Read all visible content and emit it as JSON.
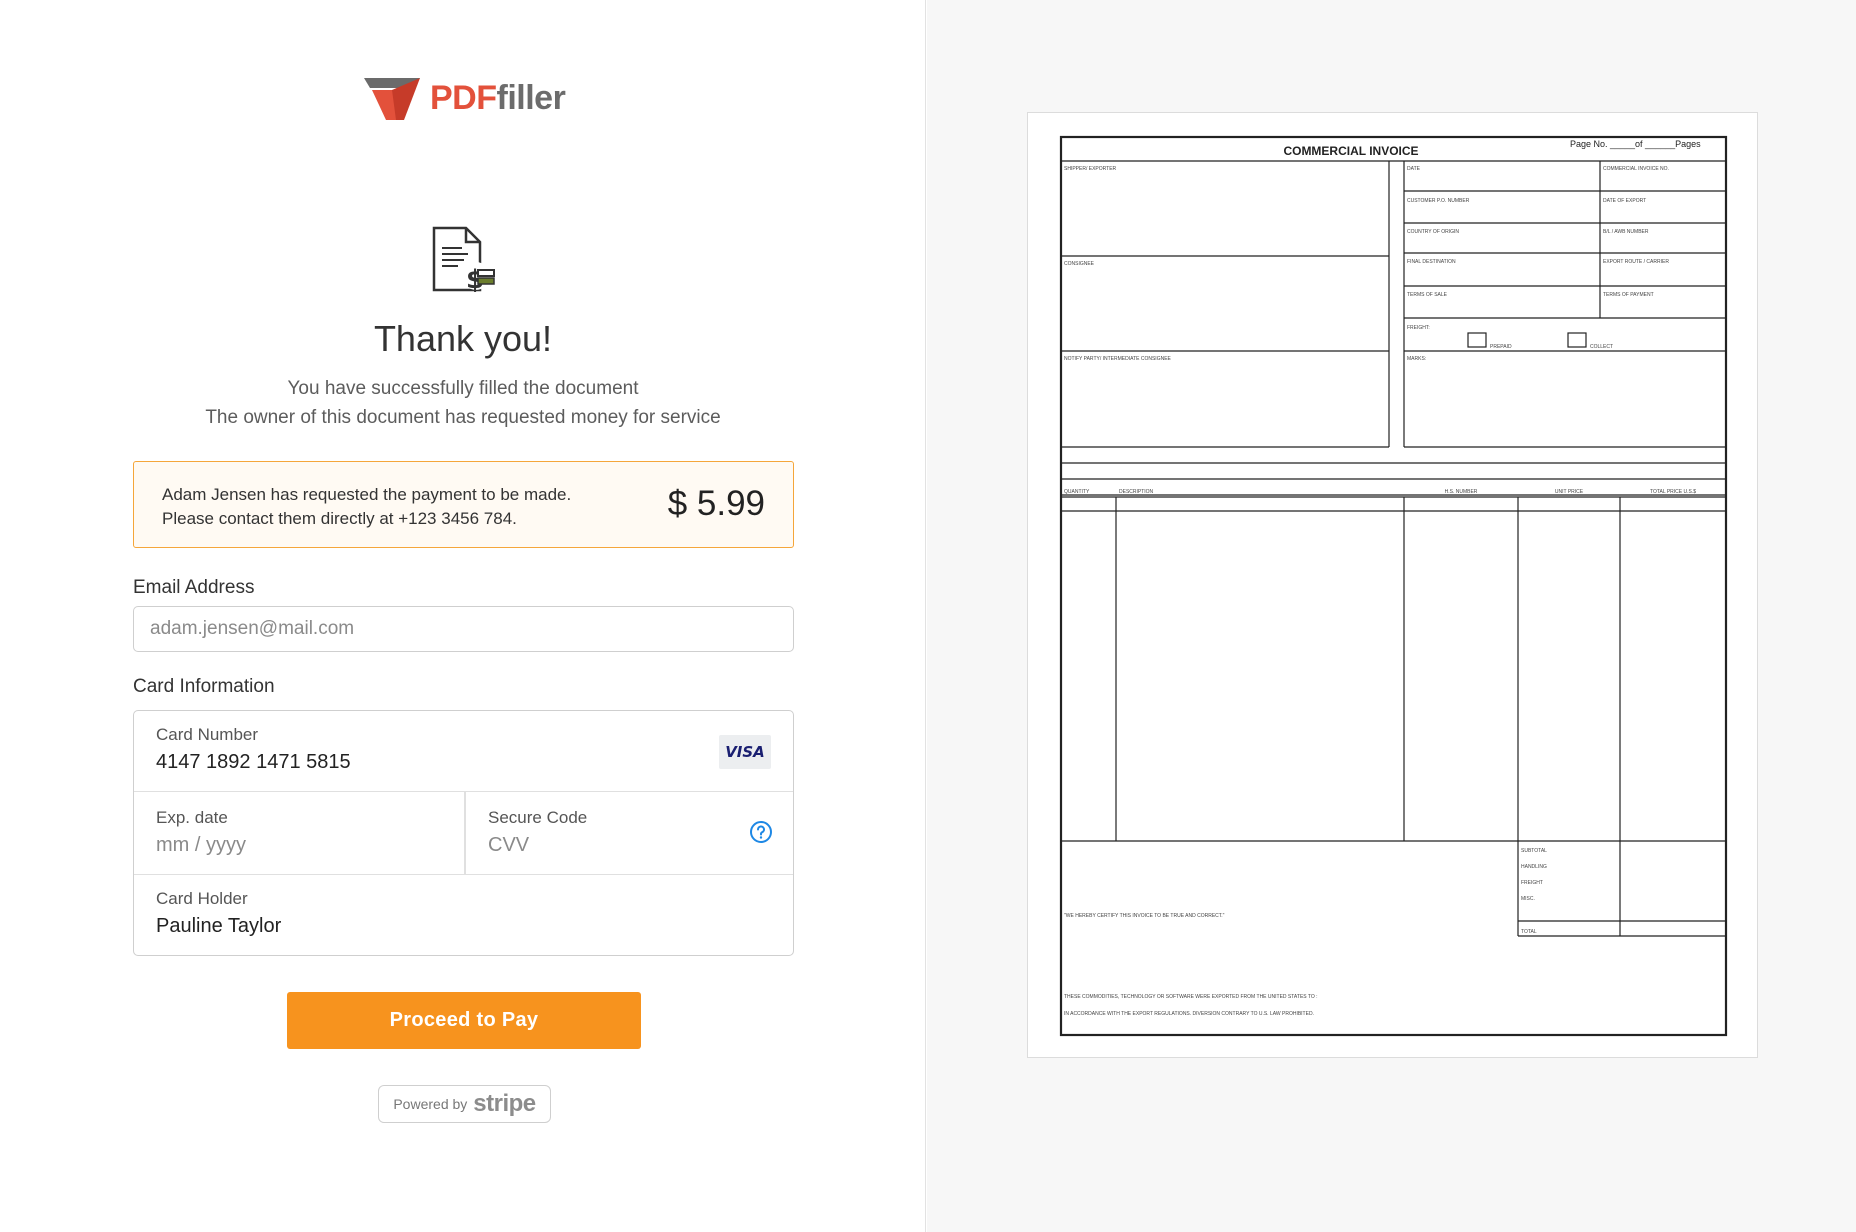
{
  "brand": {
    "pdf": "PDF",
    "filler": "filler"
  },
  "success": {
    "title": "Thank you!",
    "line1": "You have successfully filled the document",
    "line2": "The owner of this document has requested money for service"
  },
  "notice": {
    "line1": "Adam Jensen has requested the payment to be made.",
    "line2": "Please contact them directly at +123 3456 784.",
    "amount": "$ 5.99"
  },
  "email": {
    "label": "Email Address",
    "placeholder": "adam.jensen@mail.com"
  },
  "card": {
    "section_label": "Card Information",
    "number_label": "Card Number",
    "number_value": "4147 1892 1471 5815",
    "brand": "VISA",
    "exp_label": "Exp. date",
    "exp_placeholder": "mm / yyyy",
    "cvv_label": "Secure Code",
    "cvv_placeholder": "CVV",
    "holder_label": "Card Holder",
    "holder_value": "Pauline Taylor"
  },
  "actions": {
    "pay": "Proceed to Pay"
  },
  "stripe": {
    "prefix": "Powered by",
    "brand": "stripe"
  },
  "colors": {
    "accent": "#f7931e",
    "notice_border": "#f5a63a",
    "logo_red": "#e3513b",
    "help_blue": "#1e88e5"
  },
  "document": {
    "title": "COMMERCIAL INVOICE",
    "page_no": "Page No. _____of ______Pages",
    "fields": {
      "shipper": "SHIPPER/ EXPORTER",
      "consignee": "CONSIGNEE",
      "notify": "NOTIFY PARTY/ INTERMEDIATE CONSIGNEE",
      "date": "DATE",
      "invoice_no": "COMMERCIAL INVOICE NO.",
      "customer_po": "CUSTOMER P.O. NUMBER",
      "date_export": "DATE OF EXPORT",
      "country_origin": "COUNTRY OF ORIGIN",
      "awb": "B/L / AWB NUMBER",
      "final_dest": "FINAL DESTINATION",
      "export_route": "EXPORT ROUTE / CARRIER",
      "terms_sale": "TERMS OF SALE",
      "terms_payment": "TERMS OF PAYMENT",
      "freight": "FREIGHT:",
      "prepaid": "PREPAID",
      "collect": "COLLECT",
      "marks": "MARKS:"
    },
    "columns": [
      "QUANTITY",
      "DESCRIPTION",
      "H.S. NUMBER",
      "UNIT PRICE",
      "TOTAL PRICE U.S.$"
    ],
    "totals": [
      "SUBTOTAL",
      "HANDLING",
      "FREIGHT",
      "MISC.",
      "TOTAL"
    ],
    "certify": "\"WE HEREBY CERTIFY THIS INVOICE TO BE TRUE AND CORRECT.\"",
    "footer1": "THESE COMMODITIES, TECHNOLOGY OR SOFTWARE WERE EXPORTED FROM THE UNITED STATES TO :",
    "footer2": "IN ACCORDANCE WITH THE EXPORT REGULATIONS.  DIVERSION CONTRARY TO U.S. LAW PROHIBITED."
  }
}
